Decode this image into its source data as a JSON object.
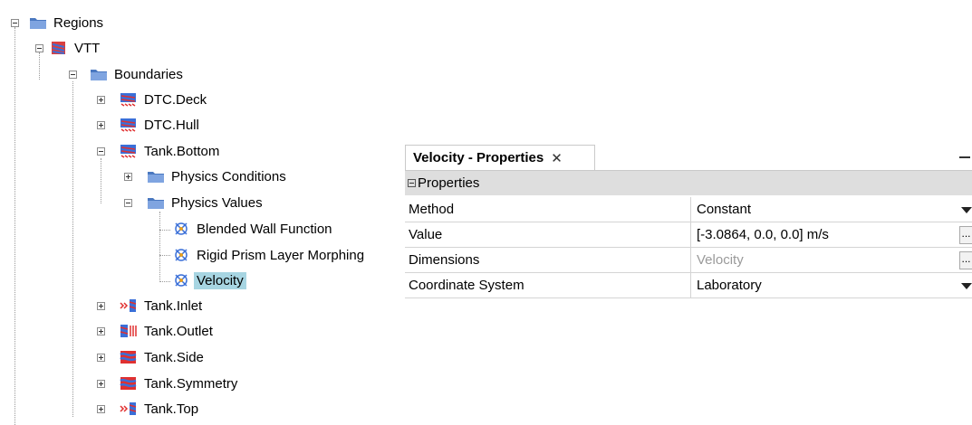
{
  "tree": {
    "regions": "Regions",
    "region": "VTT",
    "boundaries": "Boundaries",
    "items": [
      {
        "label": "DTC.Deck"
      },
      {
        "label": "DTC.Hull"
      },
      {
        "label": "Tank.Bottom"
      },
      {
        "label": "Physics Conditions"
      },
      {
        "label": "Physics Values"
      },
      {
        "label": "Blended Wall Function"
      },
      {
        "label": "Rigid Prism Layer Morphing"
      },
      {
        "label": "Velocity"
      },
      {
        "label": "Tank.Inlet"
      },
      {
        "label": "Tank.Outlet"
      },
      {
        "label": "Tank.Side"
      },
      {
        "label": "Tank.Symmetry"
      },
      {
        "label": "Tank.Top"
      }
    ]
  },
  "panel": {
    "tab_title": "Velocity - Properties",
    "close_glyph": "✕",
    "section": "Properties",
    "rows": [
      {
        "name": "Method",
        "value": "Constant"
      },
      {
        "name": "Value",
        "value": "[-3.0864, 0.0, 0.0] m/s"
      },
      {
        "name": "Dimensions",
        "value": "Velocity"
      },
      {
        "name": "Coordinate System",
        "value": "Laboratory"
      }
    ],
    "ellipsis": "..."
  },
  "colors": {
    "folder": "#4a78c0",
    "selection": "#a7d5e2",
    "section_bg": "#dedede",
    "boundary_red": "#e03030",
    "boundary_blue": "#3a6fd8"
  },
  "icons": [
    "folder-icon",
    "region-icon",
    "boundary-wall-icon",
    "boundary-inlet-icon",
    "boundary-outlet-icon",
    "boundary-symmetry-icon",
    "physics-value-icon"
  ]
}
